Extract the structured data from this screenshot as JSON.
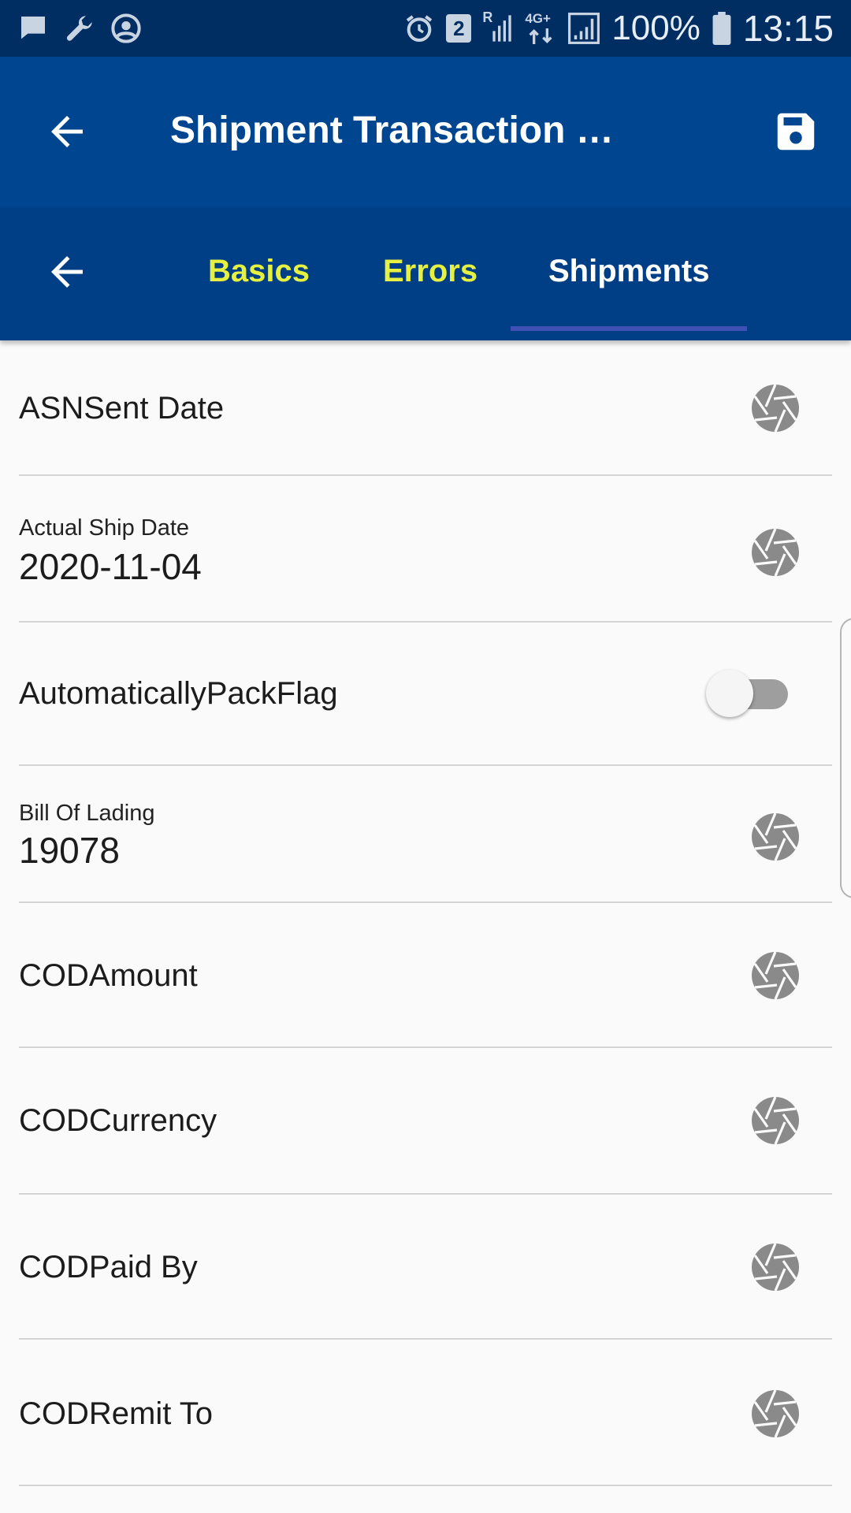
{
  "status_bar": {
    "battery_percent": "100%",
    "time": "13:15",
    "notification_badge": "2",
    "network_label": "4G+",
    "roaming_label": "R",
    "icons": [
      "chat-icon",
      "wrench-icon",
      "account-circle-icon",
      "alarm-icon",
      "sim-badge-icon",
      "signal-icon",
      "data-arrows-icon",
      "signal-box-icon",
      "battery-icon"
    ]
  },
  "app_bar": {
    "title": "Shipment Transaction …",
    "back_icon": "arrow-back-icon",
    "save_icon": "save-icon"
  },
  "tabs": {
    "back_icon": "arrow-back-icon",
    "items": [
      {
        "label": "Basics",
        "active": false
      },
      {
        "label": "Errors",
        "active": false
      },
      {
        "label": "Shipments",
        "active": true
      }
    ],
    "colors": {
      "inactive": "#e6f041",
      "active": "#ffffff",
      "indicator": "#3f51b5"
    }
  },
  "fields": [
    {
      "label": "ASNSent Date",
      "value": "",
      "control": "aperture-icon"
    },
    {
      "label": "Actual Ship Date",
      "value": "2020-11-04",
      "control": "aperture-icon"
    },
    {
      "label": "AutomaticallyPackFlag",
      "value": "",
      "control": "toggle",
      "toggle_on": false
    },
    {
      "label": "Bill Of Lading",
      "value": "19078",
      "control": "aperture-icon"
    },
    {
      "label": "CODAmount",
      "value": "",
      "control": "aperture-icon"
    },
    {
      "label": "CODCurrency",
      "value": "",
      "control": "aperture-icon"
    },
    {
      "label": "CODPaid By",
      "value": "",
      "control": "aperture-icon"
    },
    {
      "label": "CODRemit To",
      "value": "",
      "control": "aperture-icon"
    }
  ],
  "colors": {
    "status_bar": "#002e63",
    "app_bar": "#00458f",
    "tab_bar": "#003f86",
    "background": "#fafafa",
    "icon_gray": "#8a8a8a"
  }
}
